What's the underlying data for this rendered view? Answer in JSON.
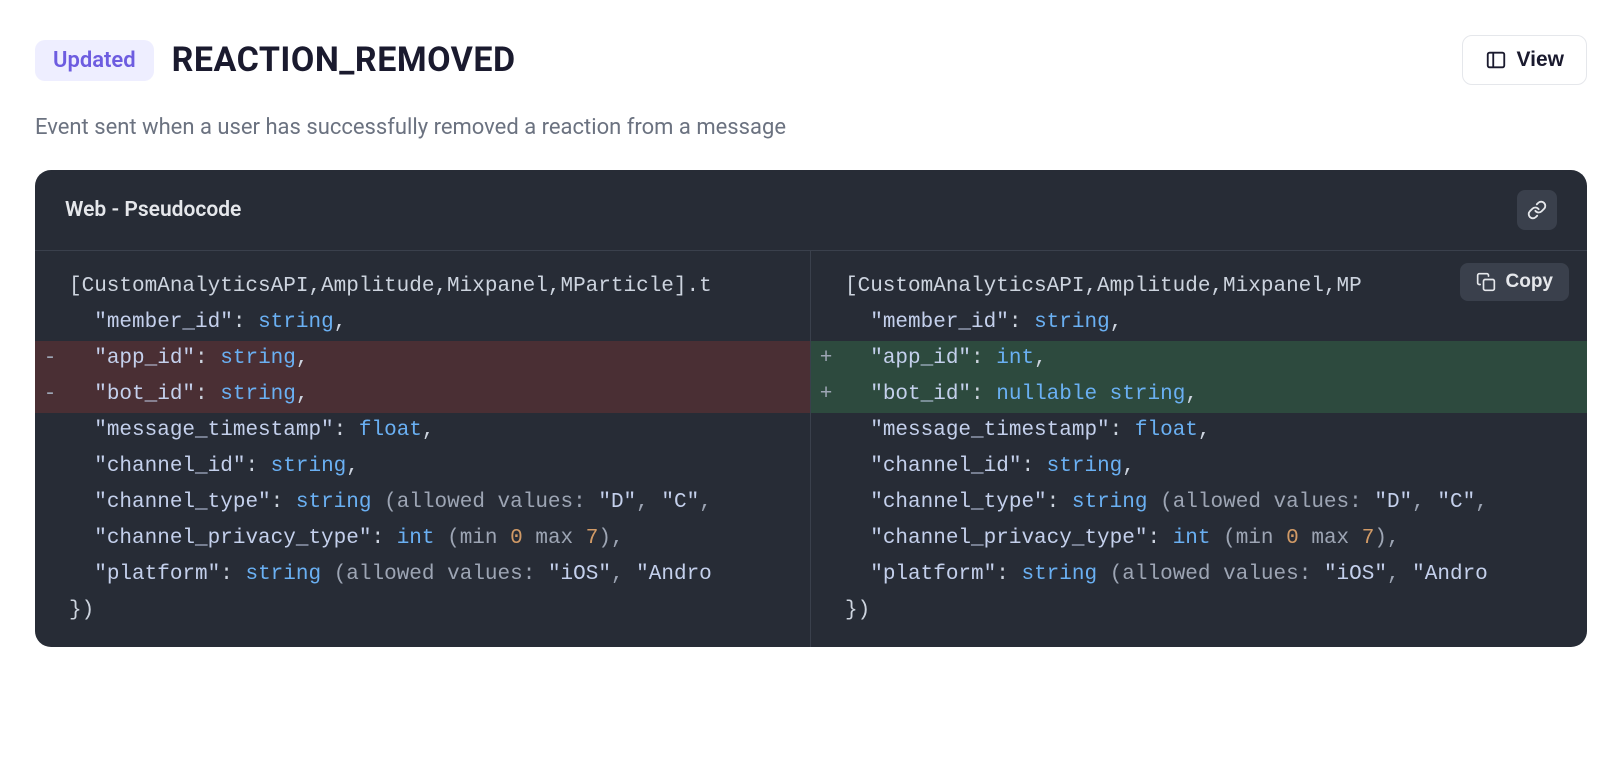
{
  "header": {
    "badge": "Updated",
    "title": "REACTION_REMOVED",
    "view_button": "View"
  },
  "description": "Event sent when a user has successfully removed a reaction from a message",
  "code": {
    "header_title": "Web - Pseudocode",
    "copy_label": "Copy",
    "left": {
      "lines": [
        {
          "marker": "",
          "kind": "context",
          "segments": [
            {
              "t": "[CustomAnalyticsAPI,Amplitude,Mixpanel,MParticle]",
              "c": "punc"
            },
            {
              "t": ".t",
              "c": "punc"
            }
          ]
        },
        {
          "marker": "",
          "kind": "context",
          "segments": [
            {
              "t": "  ",
              "c": "punc"
            },
            {
              "t": "\"member_id\"",
              "c": "str"
            },
            {
              "t": ": ",
              "c": "punc"
            },
            {
              "t": "string",
              "c": "type"
            },
            {
              "t": ",",
              "c": "punc"
            }
          ]
        },
        {
          "marker": "-",
          "kind": "removed",
          "segments": [
            {
              "t": "  ",
              "c": "punc"
            },
            {
              "t": "\"app_id\"",
              "c": "str"
            },
            {
              "t": ": ",
              "c": "punc"
            },
            {
              "t": "string",
              "c": "type"
            },
            {
              "t": ",",
              "c": "punc"
            }
          ]
        },
        {
          "marker": "-",
          "kind": "removed",
          "segments": [
            {
              "t": "  ",
              "c": "punc"
            },
            {
              "t": "\"bot_id\"",
              "c": "str"
            },
            {
              "t": ": ",
              "c": "punc"
            },
            {
              "t": "string",
              "c": "type"
            },
            {
              "t": ",",
              "c": "punc"
            }
          ]
        },
        {
          "marker": "",
          "kind": "context",
          "segments": [
            {
              "t": "  ",
              "c": "punc"
            },
            {
              "t": "\"message_timestamp\"",
              "c": "str"
            },
            {
              "t": ": ",
              "c": "punc"
            },
            {
              "t": "float",
              "c": "type"
            },
            {
              "t": ",",
              "c": "punc"
            }
          ]
        },
        {
          "marker": "",
          "kind": "context",
          "segments": [
            {
              "t": "  ",
              "c": "punc"
            },
            {
              "t": "\"channel_id\"",
              "c": "str"
            },
            {
              "t": ": ",
              "c": "punc"
            },
            {
              "t": "string",
              "c": "type"
            },
            {
              "t": ",",
              "c": "punc"
            }
          ]
        },
        {
          "marker": "",
          "kind": "context",
          "segments": [
            {
              "t": "  ",
              "c": "punc"
            },
            {
              "t": "\"channel_type\"",
              "c": "str"
            },
            {
              "t": ": ",
              "c": "punc"
            },
            {
              "t": "string",
              "c": "type"
            },
            {
              "t": " (allowed values: ",
              "c": "paren"
            },
            {
              "t": "\"D\"",
              "c": "str"
            },
            {
              "t": ", ",
              "c": "paren"
            },
            {
              "t": "\"C\"",
              "c": "str"
            },
            {
              "t": ",",
              "c": "paren"
            }
          ]
        },
        {
          "marker": "",
          "kind": "context",
          "segments": [
            {
              "t": "  ",
              "c": "punc"
            },
            {
              "t": "\"channel_privacy_type\"",
              "c": "str"
            },
            {
              "t": ": ",
              "c": "punc"
            },
            {
              "t": "int",
              "c": "type"
            },
            {
              "t": " (min ",
              "c": "paren"
            },
            {
              "t": "0",
              "c": "num"
            },
            {
              "t": " max ",
              "c": "paren"
            },
            {
              "t": "7",
              "c": "num"
            },
            {
              "t": "),",
              "c": "paren"
            }
          ]
        },
        {
          "marker": "",
          "kind": "context",
          "segments": [
            {
              "t": "  ",
              "c": "punc"
            },
            {
              "t": "\"platform\"",
              "c": "str"
            },
            {
              "t": ": ",
              "c": "punc"
            },
            {
              "t": "string",
              "c": "type"
            },
            {
              "t": " (allowed values: ",
              "c": "paren"
            },
            {
              "t": "\"iOS\"",
              "c": "str"
            },
            {
              "t": ", ",
              "c": "paren"
            },
            {
              "t": "\"Andro",
              "c": "str"
            }
          ]
        },
        {
          "marker": "",
          "kind": "context",
          "segments": [
            {
              "t": "})",
              "c": "punc"
            }
          ]
        }
      ]
    },
    "right": {
      "lines": [
        {
          "marker": "",
          "kind": "context",
          "segments": [
            {
              "t": "[CustomAnalyticsAPI,Amplitude,Mixpanel,MP",
              "c": "punc"
            }
          ]
        },
        {
          "marker": "",
          "kind": "context",
          "segments": [
            {
              "t": "  ",
              "c": "punc"
            },
            {
              "t": "\"member_id\"",
              "c": "str"
            },
            {
              "t": ": ",
              "c": "punc"
            },
            {
              "t": "string",
              "c": "type"
            },
            {
              "t": ",",
              "c": "punc"
            }
          ]
        },
        {
          "marker": "+",
          "kind": "added",
          "segments": [
            {
              "t": "  ",
              "c": "punc"
            },
            {
              "t": "\"app_id\"",
              "c": "str"
            },
            {
              "t": ": ",
              "c": "punc"
            },
            {
              "t": "int",
              "c": "type"
            },
            {
              "t": ",",
              "c": "punc"
            }
          ]
        },
        {
          "marker": "+",
          "kind": "added",
          "segments": [
            {
              "t": "  ",
              "c": "punc"
            },
            {
              "t": "\"bot_id\"",
              "c": "str"
            },
            {
              "t": ": ",
              "c": "punc"
            },
            {
              "t": "nullable string",
              "c": "type"
            },
            {
              "t": ",",
              "c": "punc"
            }
          ]
        },
        {
          "marker": "",
          "kind": "context",
          "segments": [
            {
              "t": "  ",
              "c": "punc"
            },
            {
              "t": "\"message_timestamp\"",
              "c": "str"
            },
            {
              "t": ": ",
              "c": "punc"
            },
            {
              "t": "float",
              "c": "type"
            },
            {
              "t": ",",
              "c": "punc"
            }
          ]
        },
        {
          "marker": "",
          "kind": "context",
          "segments": [
            {
              "t": "  ",
              "c": "punc"
            },
            {
              "t": "\"channel_id\"",
              "c": "str"
            },
            {
              "t": ": ",
              "c": "punc"
            },
            {
              "t": "string",
              "c": "type"
            },
            {
              "t": ",",
              "c": "punc"
            }
          ]
        },
        {
          "marker": "",
          "kind": "context",
          "segments": [
            {
              "t": "  ",
              "c": "punc"
            },
            {
              "t": "\"channel_type\"",
              "c": "str"
            },
            {
              "t": ": ",
              "c": "punc"
            },
            {
              "t": "string",
              "c": "type"
            },
            {
              "t": " (allowed values: ",
              "c": "paren"
            },
            {
              "t": "\"D\"",
              "c": "str"
            },
            {
              "t": ", ",
              "c": "paren"
            },
            {
              "t": "\"C\"",
              "c": "str"
            },
            {
              "t": ",",
              "c": "paren"
            }
          ]
        },
        {
          "marker": "",
          "kind": "context",
          "segments": [
            {
              "t": "  ",
              "c": "punc"
            },
            {
              "t": "\"channel_privacy_type\"",
              "c": "str"
            },
            {
              "t": ": ",
              "c": "punc"
            },
            {
              "t": "int",
              "c": "type"
            },
            {
              "t": " (min ",
              "c": "paren"
            },
            {
              "t": "0",
              "c": "num"
            },
            {
              "t": " max ",
              "c": "paren"
            },
            {
              "t": "7",
              "c": "num"
            },
            {
              "t": "),",
              "c": "paren"
            }
          ]
        },
        {
          "marker": "",
          "kind": "context",
          "segments": [
            {
              "t": "  ",
              "c": "punc"
            },
            {
              "t": "\"platform\"",
              "c": "str"
            },
            {
              "t": ": ",
              "c": "punc"
            },
            {
              "t": "string",
              "c": "type"
            },
            {
              "t": " (allowed values: ",
              "c": "paren"
            },
            {
              "t": "\"iOS\"",
              "c": "str"
            },
            {
              "t": ", ",
              "c": "paren"
            },
            {
              "t": "\"Andro",
              "c": "str"
            }
          ]
        },
        {
          "marker": "",
          "kind": "context",
          "segments": [
            {
              "t": "})",
              "c": "punc"
            }
          ]
        }
      ]
    }
  }
}
